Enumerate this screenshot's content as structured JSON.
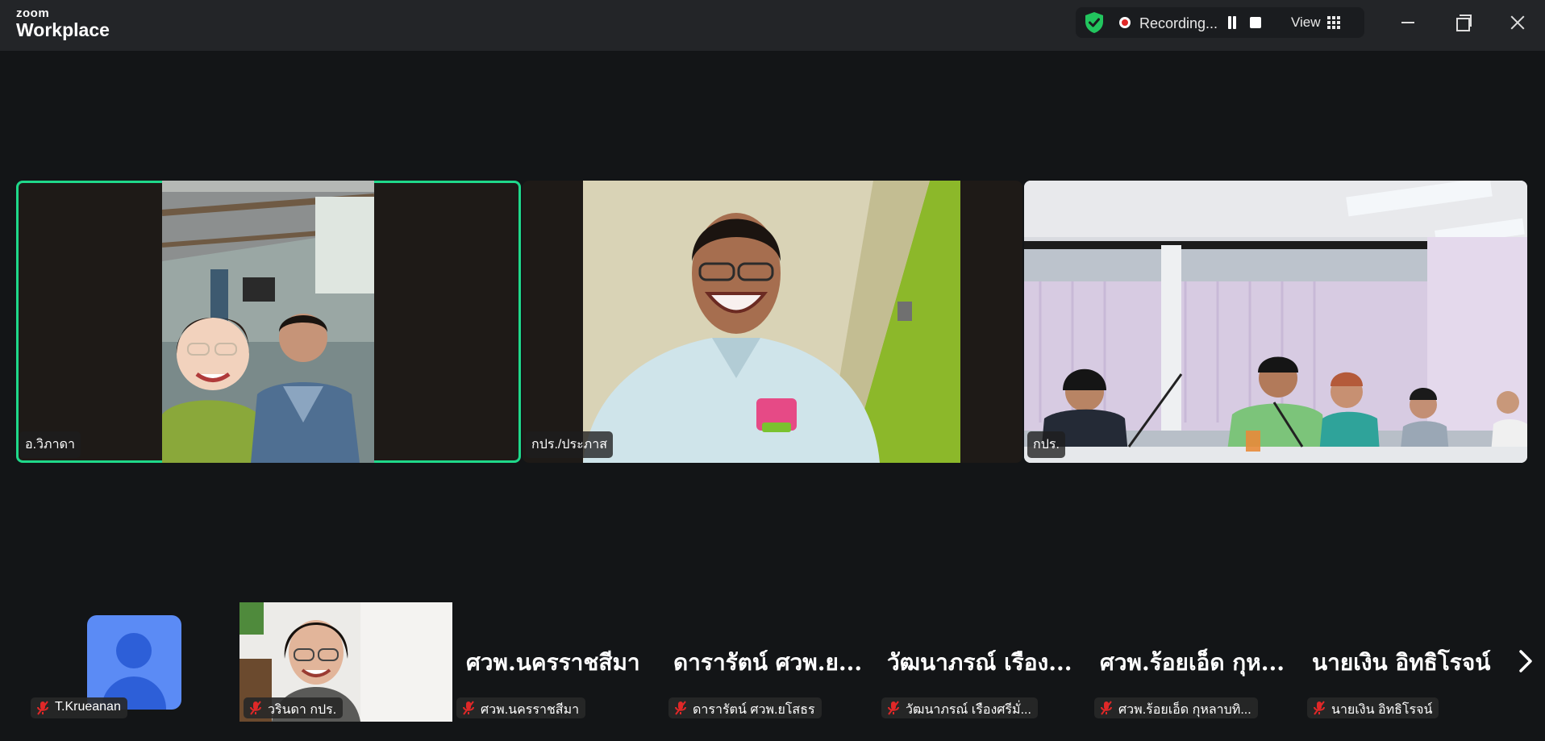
{
  "app": {
    "logo_small": "zoom",
    "logo_big": "Workplace"
  },
  "recording": {
    "status": "Recording...",
    "view_label": "View"
  },
  "tiles": [
    {
      "name": "อ.วิภาดา",
      "active": true
    },
    {
      "name": "กปร./ประภาส",
      "active": false
    },
    {
      "name": "กปร.",
      "active": false
    }
  ],
  "strip": [
    {
      "display": "",
      "tag": "T.Krueanan",
      "muted": true
    },
    {
      "display": "",
      "tag": "วรินดา กปร.",
      "muted": true
    },
    {
      "display": "ศวพ.นครราชสีมา",
      "tag": "ศวพ.นครราชสีมา",
      "muted": true
    },
    {
      "display": "ดารารัตน์ ศวพ.ย...",
      "tag": "ดารารัตน์ ศวพ.ยโสธร",
      "muted": true
    },
    {
      "display": "วัฒนาภรณ์ เรือง...",
      "tag": "วัฒนาภรณ์ เรืองศรีมั่...",
      "muted": true
    },
    {
      "display": "ศวพ.ร้อยเอ็ด กุห...",
      "tag": "ศวพ.ร้อยเอ็ด กุหลาบทิ...",
      "muted": true
    },
    {
      "display": "นายเงิน อิทธิโรจน์",
      "tag": "นายเงิน อิทธิโรจน์",
      "muted": true
    }
  ],
  "colors": {
    "active_border": "#1fd88a",
    "shield": "#22c55e",
    "rec_dot": "#e02828",
    "avatar_bg": "#5b8bf5",
    "mute": "#e02828"
  },
  "icons": [
    "shield-check-icon",
    "record-icon",
    "pause-icon",
    "stop-icon",
    "grid-view-icon",
    "minimize-icon",
    "maximize-icon",
    "close-icon",
    "mic-muted-icon",
    "user-avatar-icon",
    "chevron-right-icon"
  ]
}
